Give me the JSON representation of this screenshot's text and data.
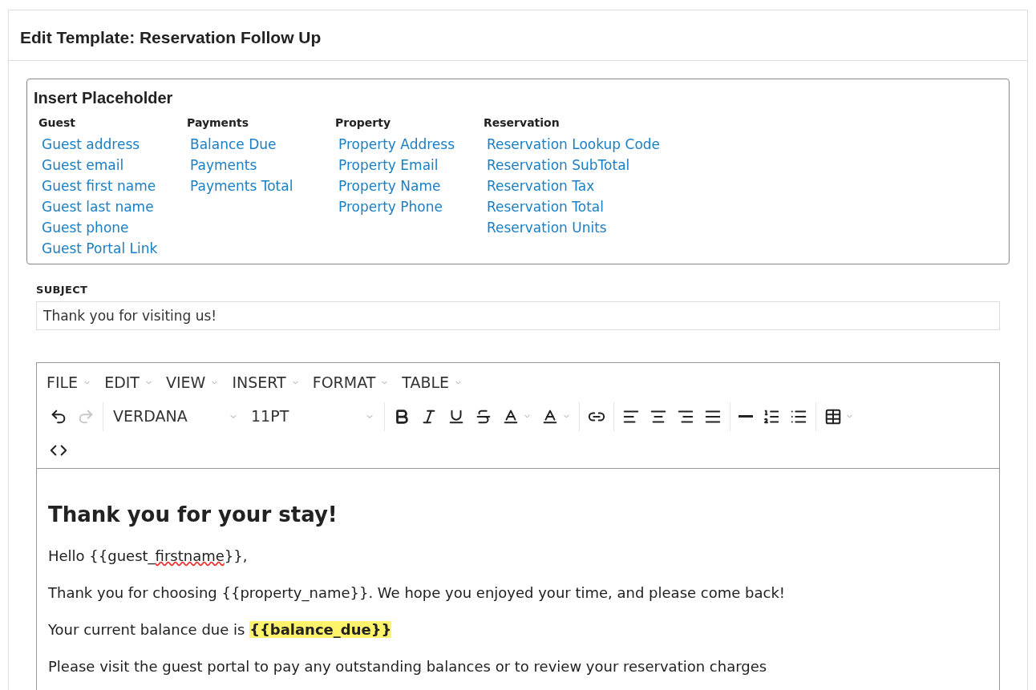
{
  "title": "Edit Template: Reservation Follow Up",
  "placeholder_panel": {
    "title": "Insert Placeholder",
    "groups": [
      {
        "heading": "Guest",
        "links": [
          "Guest address",
          "Guest email",
          "Guest first name",
          "Guest last name",
          "Guest phone",
          "Guest Portal Link"
        ]
      },
      {
        "heading": "Payments",
        "links": [
          "Balance Due",
          "Payments",
          "Payments Total"
        ]
      },
      {
        "heading": "Property",
        "links": [
          "Property Address",
          "Property Email",
          "Property Name",
          "Property Phone"
        ]
      },
      {
        "heading": "Reservation",
        "links": [
          "Reservation Lookup Code",
          "Reservation SubTotal",
          "Reservation Tax",
          "Reservation Total",
          "Reservation Units"
        ]
      }
    ]
  },
  "subject": {
    "label": "SUBJECT",
    "value": "Thank you for visiting us!"
  },
  "editor": {
    "menus": [
      "FILE",
      "EDIT",
      "VIEW",
      "INSERT",
      "FORMAT",
      "TABLE"
    ],
    "toolbar": [
      [
        {
          "kind": "undo",
          "disabled": false
        },
        {
          "kind": "redo",
          "disabled": true
        }
      ],
      [
        {
          "kind": "font",
          "label": "VERDANA"
        },
        {
          "kind": "size",
          "label": "11PT"
        }
      ],
      [
        {
          "kind": "bold"
        },
        {
          "kind": "italic"
        },
        {
          "kind": "underline"
        },
        {
          "kind": "strike"
        },
        {
          "kind": "forecolor"
        },
        {
          "kind": "backcolor"
        }
      ],
      [
        {
          "kind": "link"
        }
      ],
      [
        {
          "kind": "align-left"
        },
        {
          "kind": "align-center"
        },
        {
          "kind": "align-right"
        },
        {
          "kind": "justify"
        }
      ],
      [
        {
          "kind": "hr"
        },
        {
          "kind": "ordered"
        },
        {
          "kind": "bullets"
        }
      ],
      [
        {
          "kind": "table"
        }
      ]
    ],
    "second_row": [
      {
        "kind": "code"
      }
    ],
    "heading": "Thank you for your stay!",
    "paragraphs": [
      [
        {
          "kind": "plain",
          "text": "Hello {{guest_"
        },
        {
          "kind": "misspelled",
          "text": "firstname"
        },
        {
          "kind": "plain",
          "text": "}},"
        }
      ],
      [
        {
          "kind": "plain",
          "text": "Thank you for choosing {{property_name}}. We hope you enjoyed your time, and please come back!"
        }
      ],
      [
        {
          "kind": "plain",
          "text": "Your current balance due is "
        },
        {
          "kind": "highlight",
          "text": "{{balance_due}}"
        }
      ],
      [
        {
          "kind": "plain",
          "text": "Please visit the guest portal to pay any outstanding balances or to review your reservation charges"
        }
      ]
    ]
  }
}
